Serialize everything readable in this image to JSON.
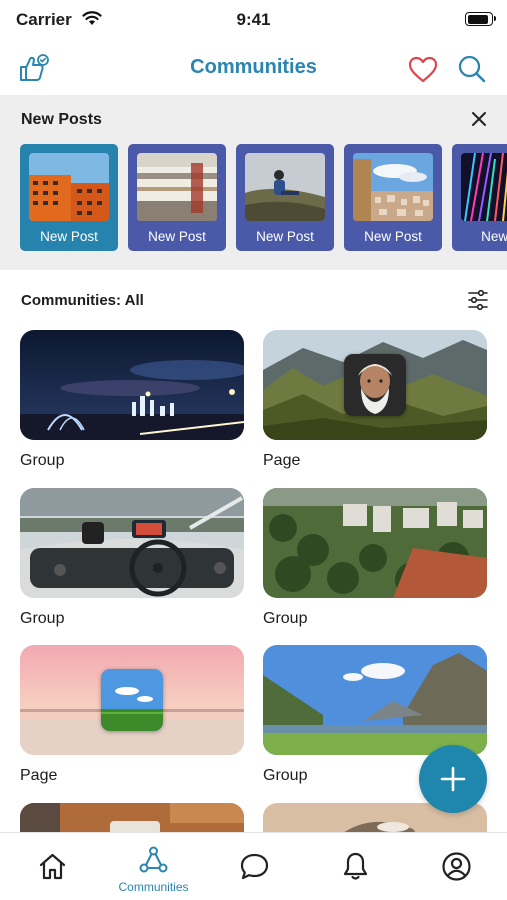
{
  "status_bar": {
    "carrier": "Carrier",
    "time": "9:41"
  },
  "nav": {
    "title": "Communities",
    "left_icon": "thumbs-up-badge-icon",
    "right_icons": [
      "heart-icon",
      "search-icon"
    ]
  },
  "new_posts": {
    "title": "New Posts",
    "items": [
      {
        "label": "New Post",
        "image": "orange-building-photo",
        "selected": true
      },
      {
        "label": "New Post",
        "image": "train-motion-blur-photo",
        "selected": false
      },
      {
        "label": "New Post",
        "image": "person-sitting-hillside-photo",
        "selected": false
      },
      {
        "label": "New Post",
        "image": "city-skyline-photo",
        "selected": false
      },
      {
        "label": "New P",
        "image": "light-trails-photo",
        "selected": false
      }
    ]
  },
  "communities": {
    "title": "Communities: All",
    "tiles": [
      {
        "label": "Group",
        "image": "night-city-bridge-photo"
      },
      {
        "label": "Page",
        "image": "mountain-valley-photo",
        "overlay": "old-man-portrait"
      },
      {
        "label": "Group",
        "image": "boat-dashboard-photo"
      },
      {
        "label": "Group",
        "image": "aerial-town-photo"
      },
      {
        "label": "Page",
        "image": "pink-sunset-beach-photo",
        "overlay": "green-field-sky"
      },
      {
        "label": "Group",
        "image": "alpine-lake-photo"
      },
      {
        "label": "",
        "image": "wooden-desk-photo"
      },
      {
        "label": "",
        "image": "sand-animal-photo"
      }
    ]
  },
  "fab": {
    "icon": "plus-icon"
  },
  "tab_bar": {
    "tabs": [
      {
        "label": "",
        "icon": "home-icon"
      },
      {
        "label": "Communities",
        "icon": "communities-icon",
        "active": true
      },
      {
        "label": "",
        "icon": "chat-bubble-icon"
      },
      {
        "label": "",
        "icon": "bell-icon"
      },
      {
        "label": "",
        "icon": "profile-icon"
      }
    ]
  },
  "colors": {
    "accent": "#2a86b0",
    "card_blue": "#4a5aa8",
    "card_selected": "#2683ad",
    "panel": "#eeeeee",
    "heart": "#e0454f"
  }
}
